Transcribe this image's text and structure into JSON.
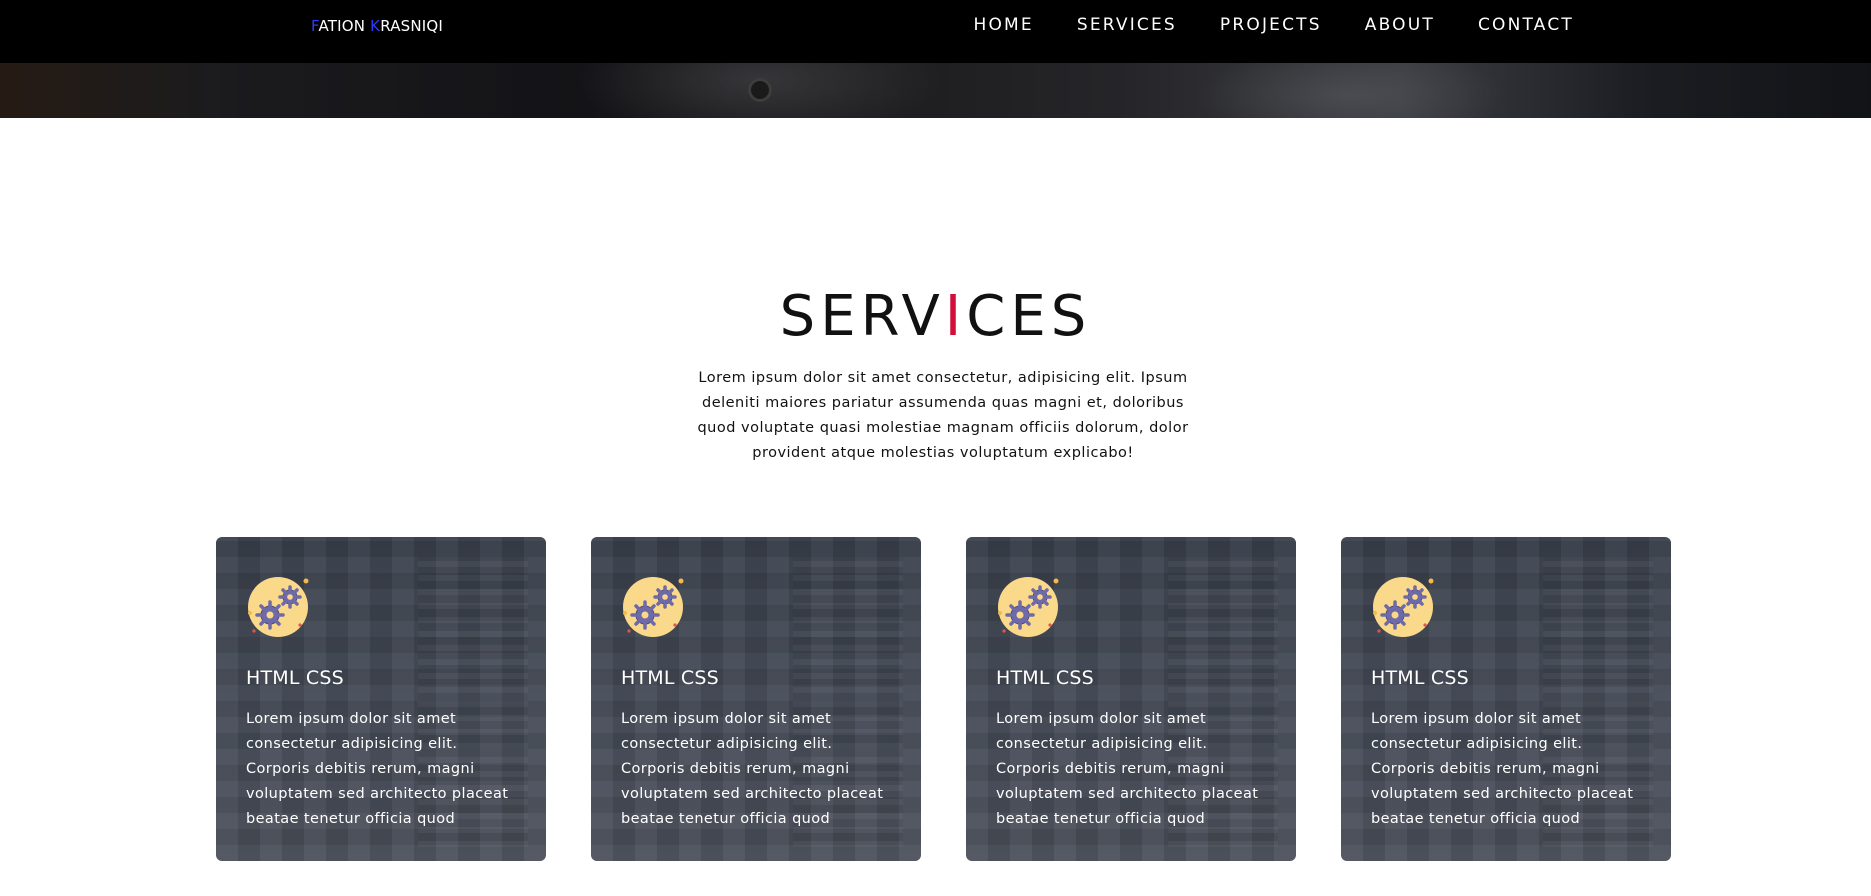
{
  "brand": {
    "first_initial": "F",
    "first_rest": "ATION ",
    "last_initial": "K",
    "last_rest": "RASNIQI"
  },
  "nav": {
    "items": [
      {
        "label": "HOME"
      },
      {
        "label": "SERVICES"
      },
      {
        "label": "PROJECTS"
      },
      {
        "label": "ABOUT"
      },
      {
        "label": "CONTACT"
      }
    ]
  },
  "services": {
    "title_part1": "SERV",
    "title_bar": "I",
    "title_part2": "CES",
    "intro": "Lorem ipsum dolor sit amet consectetur, adipisicing elit. Ipsum deleniti maiores pariatur assumenda quas magni et, doloribus quod voluptate quasi molestiae magnam officiis dolorum, dolor provident atque molestias voluptatum explicabo!",
    "cards": [
      {
        "icon": "gears-icon",
        "title": "HTML CSS",
        "text": "Lorem ipsum dolor sit amet consectetur adipisicing elit. Corporis debitis rerum, magni voluptatem sed architecto placeat beatae tenetur officia quod"
      },
      {
        "icon": "gears-icon",
        "title": "HTML CSS",
        "text": "Lorem ipsum dolor sit amet consectetur adipisicing elit. Corporis debitis rerum, magni voluptatem sed architecto placeat beatae tenetur officia quod"
      },
      {
        "icon": "gears-icon",
        "title": "HTML CSS",
        "text": "Lorem ipsum dolor sit amet consectetur adipisicing elit. Corporis debitis rerum, magni voluptatem sed architecto placeat beatae tenetur officia quod"
      },
      {
        "icon": "gears-icon",
        "title": "HTML CSS",
        "text": "Lorem ipsum dolor sit amet consectetur adipisicing elit. Corporis debitis rerum, magni voluptatem sed architecto placeat beatae tenetur officia quod"
      }
    ]
  },
  "colors": {
    "navbar_bg": "#000000",
    "brand_accent": "#2f3cf5",
    "title_accent": "#d0103a",
    "card_bg": "#414753",
    "icon_fill": "#fbd98a",
    "gear_color": "#6e6aa8"
  }
}
